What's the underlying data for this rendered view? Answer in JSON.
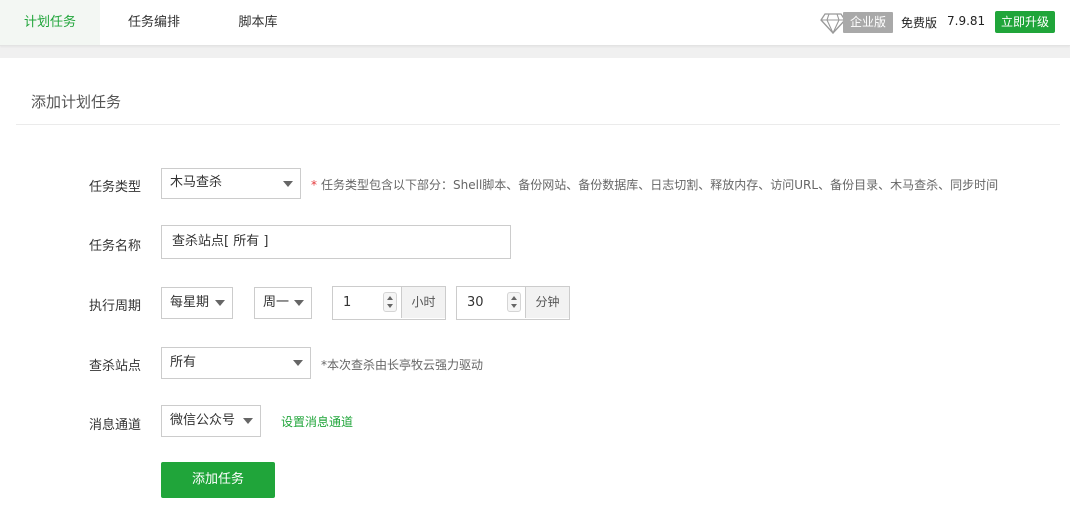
{
  "nav": {
    "tabs": [
      {
        "label": "计划任务",
        "active": true
      },
      {
        "label": "任务编排",
        "active": false
      },
      {
        "label": "脚本库",
        "active": false
      }
    ],
    "enterprise_badge": "企业版",
    "edition_label": "免费版",
    "version": "7.9.81",
    "upgrade_label": "立即升级"
  },
  "panel": {
    "title": "添加计划任务"
  },
  "form": {
    "task_type": {
      "label": "任务类型",
      "value": "木马查杀",
      "hint_star": "*",
      "hint": "任务类型包含以下部分：Shell脚本、备份网站、备份数据库、日志切割、释放内存、访问URL、备份目录、木马查杀、同步时间"
    },
    "task_name": {
      "label": "任务名称",
      "value": "查杀站点[ 所有 ]"
    },
    "period": {
      "label": "执行周期",
      "cycle_value": "每星期",
      "weekday_value": "周一",
      "hour_value": "1",
      "hour_unit": "小时",
      "minute_value": "30",
      "minute_unit": "分钟"
    },
    "scan_site": {
      "label": "查杀站点",
      "value": "所有",
      "hint": "*本次查杀由长亭牧云强力驱动"
    },
    "message_channel": {
      "label": "消息通道",
      "value": "微信公众号",
      "link": "设置消息通道"
    },
    "submit_label": "添加任务"
  },
  "colors": {
    "accent": "#20a53a",
    "required_star": "#e4393c",
    "badge_gray": "#a9a9a9"
  }
}
